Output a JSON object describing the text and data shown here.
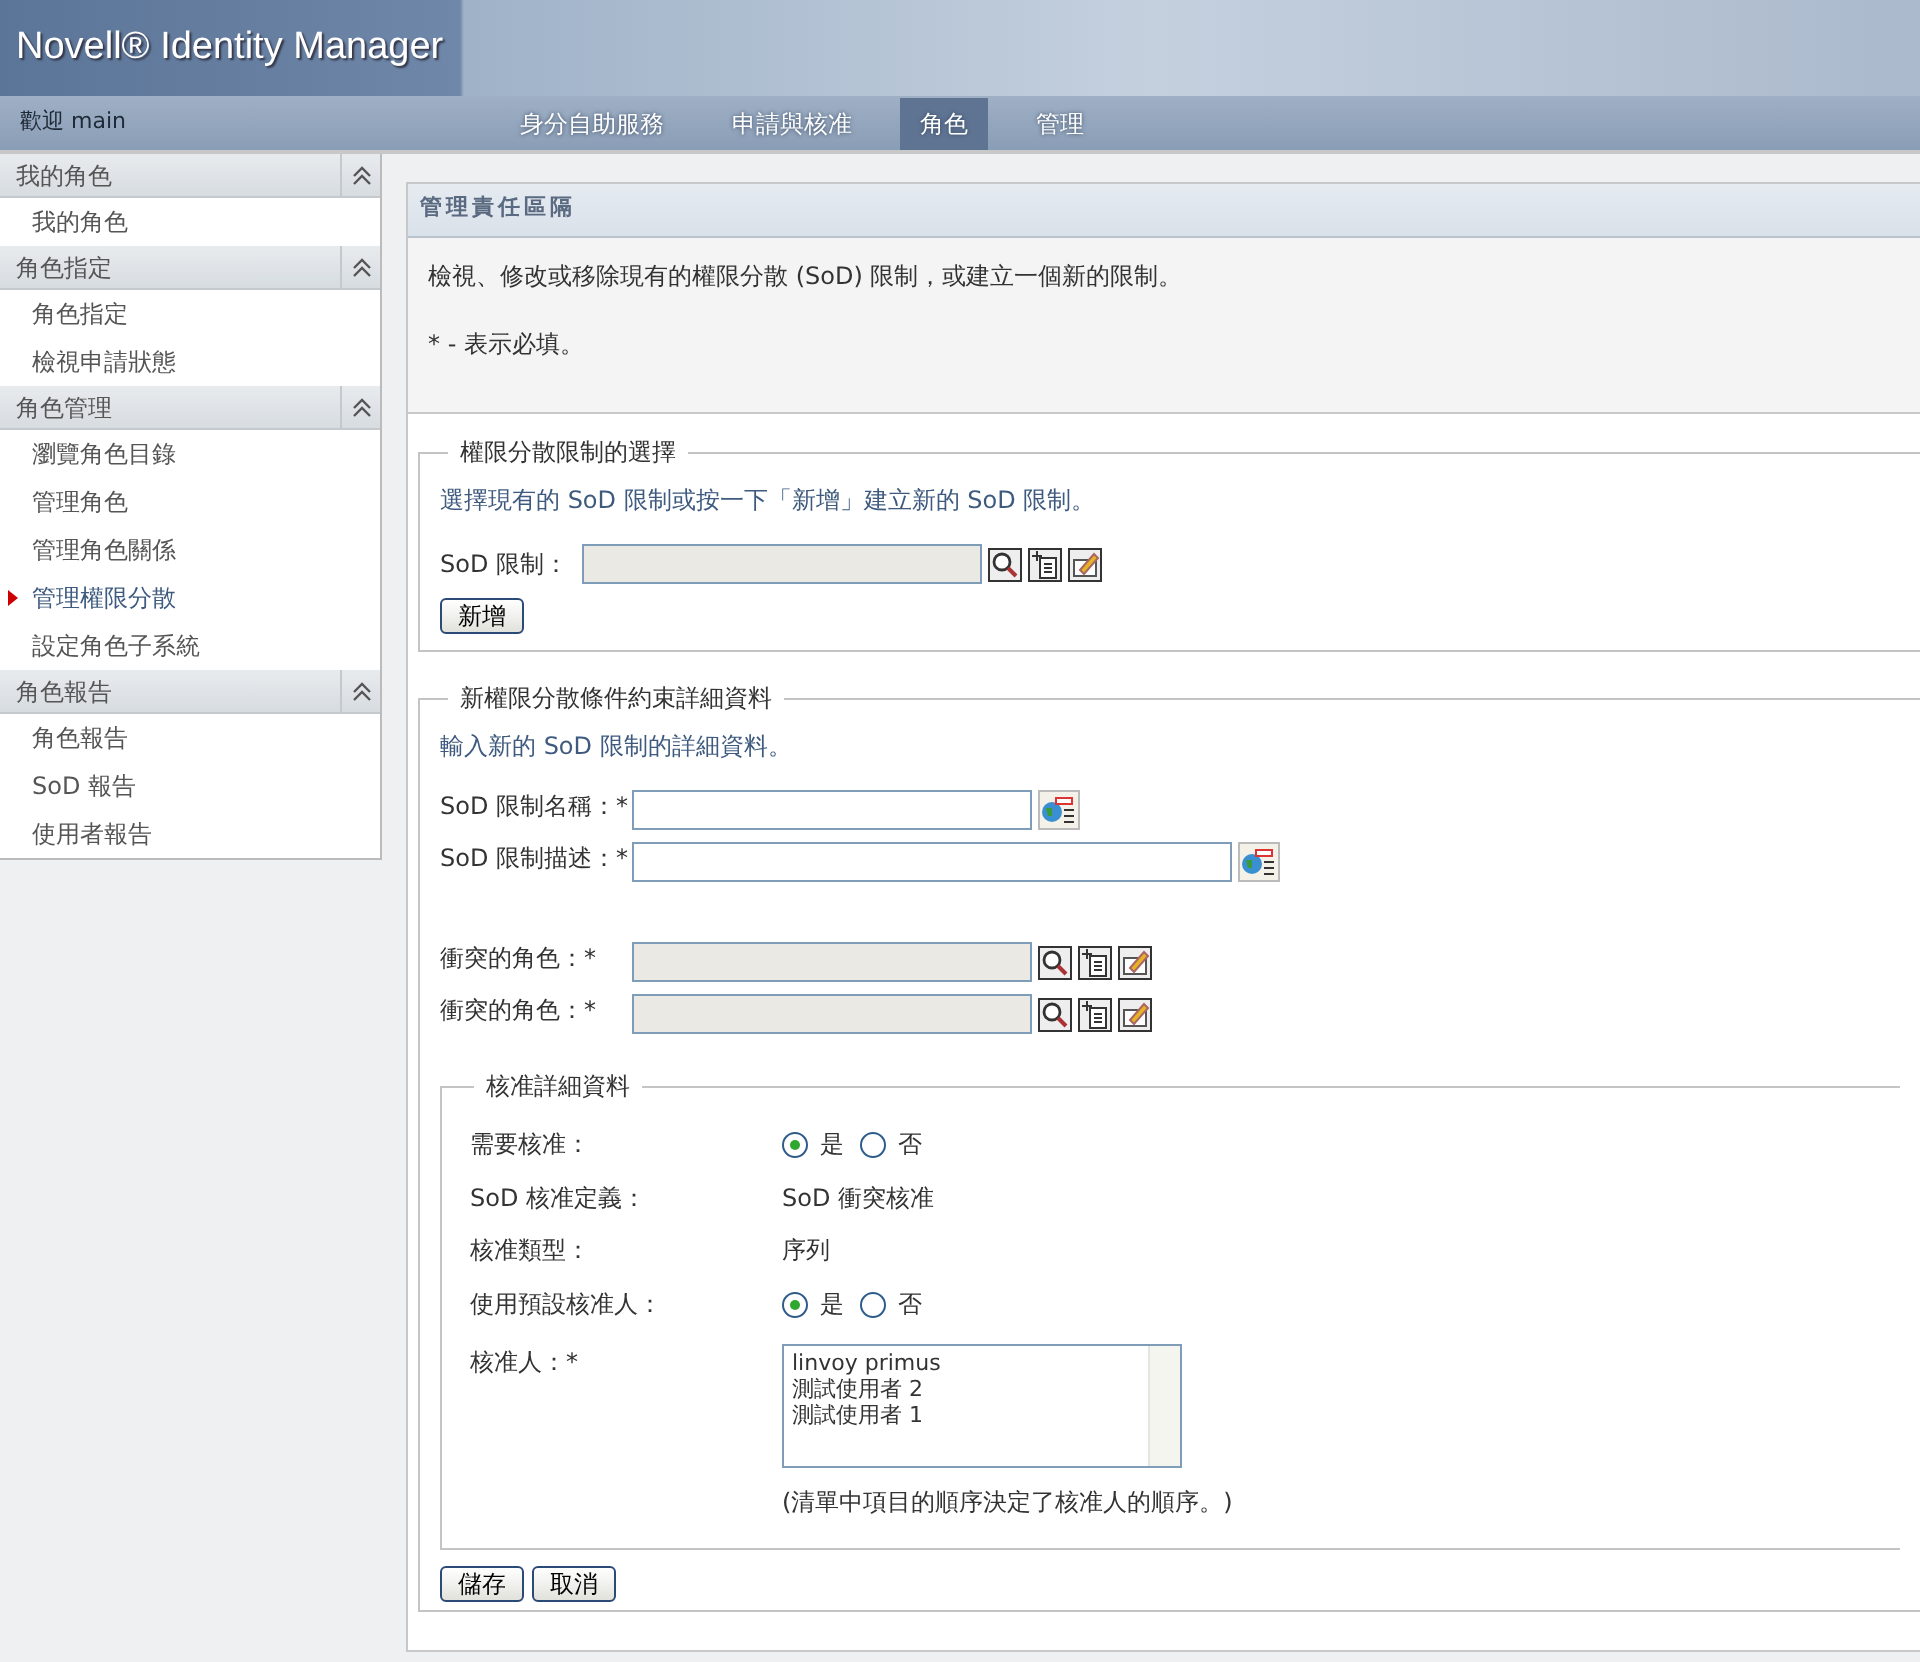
{
  "header": {
    "title": "Novell® Identity Manager"
  },
  "navbar": {
    "welcome": "歡迎 main",
    "tabs": [
      {
        "label": "身分自助服務",
        "selected": false
      },
      {
        "label": "申請與核准",
        "selected": false
      },
      {
        "label": "角色",
        "selected": true
      },
      {
        "label": "管理",
        "selected": false
      }
    ]
  },
  "sidebar": {
    "groups": [
      {
        "title": "我的角色",
        "expanded": true,
        "items": [
          {
            "label": "我的角色",
            "selected": false
          }
        ]
      },
      {
        "title": "角色指定",
        "expanded": true,
        "items": [
          {
            "label": "角色指定",
            "selected": false
          },
          {
            "label": "檢視申請狀態",
            "selected": false
          }
        ]
      },
      {
        "title": "角色管理",
        "expanded": true,
        "items": [
          {
            "label": "瀏覽角色目錄",
            "selected": false
          },
          {
            "label": "管理角色",
            "selected": false
          },
          {
            "label": "管理角色關係",
            "selected": false
          },
          {
            "label": "管理權限分散",
            "selected": true
          },
          {
            "label": "設定角色子系統",
            "selected": false
          }
        ]
      },
      {
        "title": "角色報告",
        "expanded": true,
        "items": [
          {
            "label": "角色報告",
            "selected": false
          },
          {
            "label": "SoD 報告",
            "selected": false
          },
          {
            "label": "使用者報告",
            "selected": false
          }
        ]
      }
    ]
  },
  "panel": {
    "title": "管理責任區隔",
    "intro": "檢視、修改或移除現有的權限分散 (SoD) 限制，或建立一個新的限制。",
    "required_note": "* - 表示必填。"
  },
  "selection": {
    "legend": "權限分散限制的選擇",
    "hint": "選擇現有的 SoD 限制或按一下「新增」建立新的 SoD 限制。",
    "field": {
      "label": "SoD 限制：",
      "kind": "picker"
    },
    "button": "新增"
  },
  "details": {
    "legend": "新權限分散條件約束詳細資料",
    "hint": "輸入新的 SoD 限制的詳細資料。",
    "fields": [
      {
        "label": "SoD 限制名稱：*",
        "kind": "text"
      },
      {
        "label": "SoD 限制描述：*",
        "kind": "text"
      },
      {
        "label": "衝突的角色：*",
        "kind": "picker"
      },
      {
        "label": "衝突的角色：*",
        "kind": "picker"
      }
    ]
  },
  "approval": {
    "legend": "核准詳細資料",
    "rows": [
      {
        "label": "需要核准：",
        "kind": "radio",
        "options": [
          {
            "label": "是",
            "selected": true
          },
          {
            "label": "否",
            "selected": false
          }
        ]
      },
      {
        "label": "SoD 核准定義：",
        "kind": "text",
        "value": "SoD 衝突核准"
      },
      {
        "label": "核准類型：",
        "kind": "text",
        "value": "序列"
      },
      {
        "label": "使用預設核准人：",
        "kind": "radio",
        "options": [
          {
            "label": "是",
            "selected": true
          },
          {
            "label": "否",
            "selected": false
          }
        ]
      },
      {
        "label": "核准人：*",
        "kind": "list",
        "items": [
          "linvoy primus",
          "測試使用者 2",
          "測試使用者 1"
        ],
        "note": "(清單中項目的順序決定了核准人的順序。)"
      }
    ]
  },
  "buttons": [
    "儲存",
    "取消"
  ]
}
